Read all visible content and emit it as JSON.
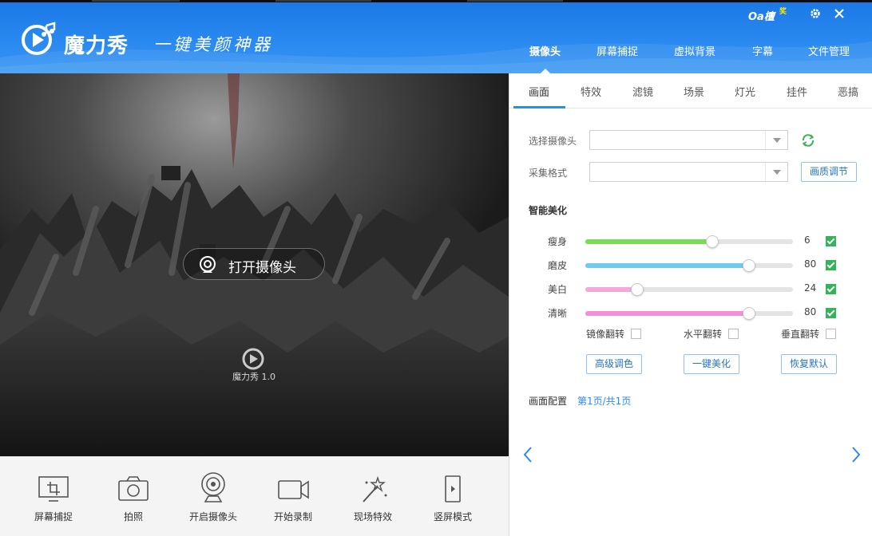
{
  "header": {
    "brand_name": "魔力秀",
    "slogan": "一键美颜神器",
    "user_label": "Oa檀",
    "user_badge": "奖"
  },
  "main_tabs": [
    {
      "label": "摄像头",
      "active": true
    },
    {
      "label": "屏幕捕捉",
      "active": false
    },
    {
      "label": "虚拟背景",
      "active": false
    },
    {
      "label": "字幕",
      "active": false
    },
    {
      "label": "文件管理",
      "active": false
    }
  ],
  "sub_tabs": [
    {
      "label": "画面",
      "active": true
    },
    {
      "label": "特效",
      "active": false
    },
    {
      "label": "滤镜",
      "active": false
    },
    {
      "label": "场景",
      "active": false
    },
    {
      "label": "灯光",
      "active": false
    },
    {
      "label": "挂件",
      "active": false
    },
    {
      "label": "恶搞",
      "active": false
    }
  ],
  "video": {
    "open_camera_label": "打开摄像头",
    "watermark": "魔力秀 1.0"
  },
  "toolbar": [
    {
      "label": "屏幕捕捉",
      "icon": "screen-capture-icon"
    },
    {
      "label": "拍照",
      "icon": "camera-icon"
    },
    {
      "label": "开启摄像头",
      "icon": "webcam-icon"
    },
    {
      "label": "开始录制",
      "icon": "video-record-icon"
    },
    {
      "label": "现场特效",
      "icon": "magic-wand-icon"
    },
    {
      "label": "竖屏模式",
      "icon": "portrait-mode-icon"
    }
  ],
  "panel": {
    "camera_select_label": "选择摄像头",
    "camera_select_value": "",
    "format_select_label": "采集格式",
    "format_select_value": "",
    "quality_button": "画质调节",
    "beauty_title": "智能美化",
    "sliders": [
      {
        "label": "瘦身",
        "value": "6",
        "fraction": 0.61,
        "color": "#7ed957",
        "checked": true
      },
      {
        "label": "磨皮",
        "value": "80",
        "fraction": 0.79,
        "color": "#6fcaec",
        "checked": true
      },
      {
        "label": "美白",
        "value": "24",
        "fraction": 0.25,
        "color": "#f5a8dc",
        "checked": true
      },
      {
        "label": "清晰",
        "value": "80",
        "fraction": 0.79,
        "color": "#f58fd9",
        "checked": true
      }
    ],
    "flip_options": [
      {
        "label": "镜像翻转",
        "checked": false
      },
      {
        "label": "水平翻转",
        "checked": false
      },
      {
        "label": "垂直翻转",
        "checked": false
      }
    ],
    "buttons": [
      "高级调色",
      "一键美化",
      "恢复默认"
    ],
    "preset_title": "画面配置",
    "page_info": "第1页/共1页"
  },
  "colors": {
    "brand_blue": "#2b8af0",
    "check_green": "#35b35a"
  }
}
